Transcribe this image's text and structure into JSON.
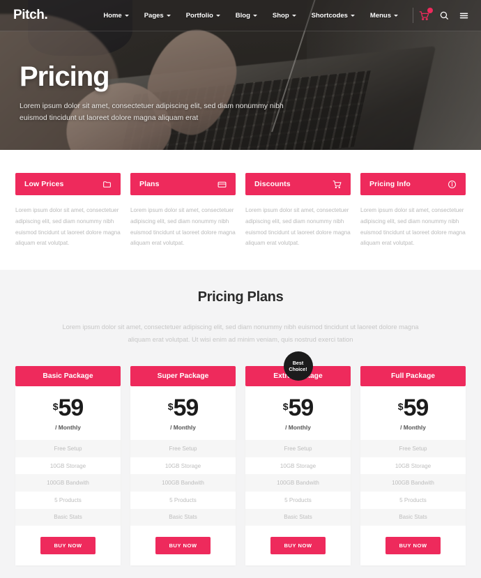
{
  "brand": {
    "logo": "Pitch."
  },
  "nav": {
    "items": [
      {
        "label": "Home",
        "caret": true
      },
      {
        "label": "Pages",
        "caret": true
      },
      {
        "label": "Portfolio",
        "caret": true
      },
      {
        "label": "Blog",
        "caret": true
      },
      {
        "label": "Shop",
        "caret": true
      },
      {
        "label": "Shortcodes",
        "caret": true
      },
      {
        "label": "Menus",
        "caret": true
      }
    ],
    "icons": [
      {
        "name": "cart-icon",
        "badge": true
      },
      {
        "name": "search-icon",
        "badge": false
      },
      {
        "name": "hamburger-menu-icon",
        "badge": false
      }
    ]
  },
  "hero": {
    "title": "Pricing",
    "subtitle": "Lorem ipsum dolor sit amet, consectetuer adipiscing elit, sed diam nonummy nibh euismod tincidunt ut laoreet dolore magna aliquam erat"
  },
  "features": [
    {
      "title": "Low Prices",
      "icon": "folder-icon",
      "text": "Lorem ipsum dolor sit amet, consectetuer adipiscing elit, sed diam nonummy nibh euismod tincidunt ut laoreet dolore magna aliquam erat volutpat."
    },
    {
      "title": "Plans",
      "icon": "credit-card-icon",
      "text": "Lorem ipsum dolor sit amet, consectetuer adipiscing elit, sed diam nonummy nibh euismod tincidunt ut laoreet dolore magna aliquam erat volutpat."
    },
    {
      "title": "Discounts",
      "icon": "shopping-cart-icon",
      "text": "Lorem ipsum dolor sit amet, consectetuer adipiscing elit, sed diam nonummy nibh euismod tincidunt ut laoreet dolore magna aliquam erat volutpat."
    },
    {
      "title": "Pricing Info",
      "icon": "info-circle-icon",
      "text": "Lorem ipsum dolor sit amet, consectetuer adipiscing elit, sed diam nonummy nibh euismod tincidunt ut laoreet dolore magna aliquam erat volutpat."
    }
  ],
  "plans_section": {
    "heading": "Pricing Plans",
    "subheading": "Lorem ipsum dolor sit amet, consectetuer adipiscing elit, sed diam nonummy nibh euismod tincidunt ut laoreet dolore magna aliquam erat volutpat. Ut wisi enim ad minim veniam, quis nostrud exerci tation"
  },
  "badge": {
    "line1": "Best",
    "line2": "Choice!"
  },
  "plans": [
    {
      "name": "Basic Package",
      "currency": "$",
      "amount": "59",
      "period": "/ Monthly",
      "features": [
        "Free Setup",
        "10GB Storage",
        "100GB Bandwith",
        "5 Products",
        "Basic Stats"
      ],
      "cta": "BUY NOW",
      "best": false
    },
    {
      "name": "Super Package",
      "currency": "$",
      "amount": "59",
      "period": "/ Monthly",
      "features": [
        "Free Setup",
        "10GB Storage",
        "100GB Bandwith",
        "5 Products",
        "Basic Stats"
      ],
      "cta": "BUY NOW",
      "best": false
    },
    {
      "name": "Extra Package",
      "currency": "$",
      "amount": "59",
      "period": "/ Monthly",
      "features": [
        "Free Setup",
        "10GB Storage",
        "100GB Bandwith",
        "5 Products",
        "Basic Stats"
      ],
      "cta": "BUY NOW",
      "best": true
    },
    {
      "name": "Full Package",
      "currency": "$",
      "amount": "59",
      "period": "/ Monthly",
      "features": [
        "Free Setup",
        "10GB Storage",
        "100GB Bandwith",
        "5 Products",
        "Basic Stats"
      ],
      "cta": "BUY NOW",
      "best": false
    }
  ],
  "colors": {
    "accent": "#ee2a5c",
    "dark": "#1c1c1c",
    "section_bg": "#f4f4f5",
    "muted_text": "#bdbdbd"
  }
}
